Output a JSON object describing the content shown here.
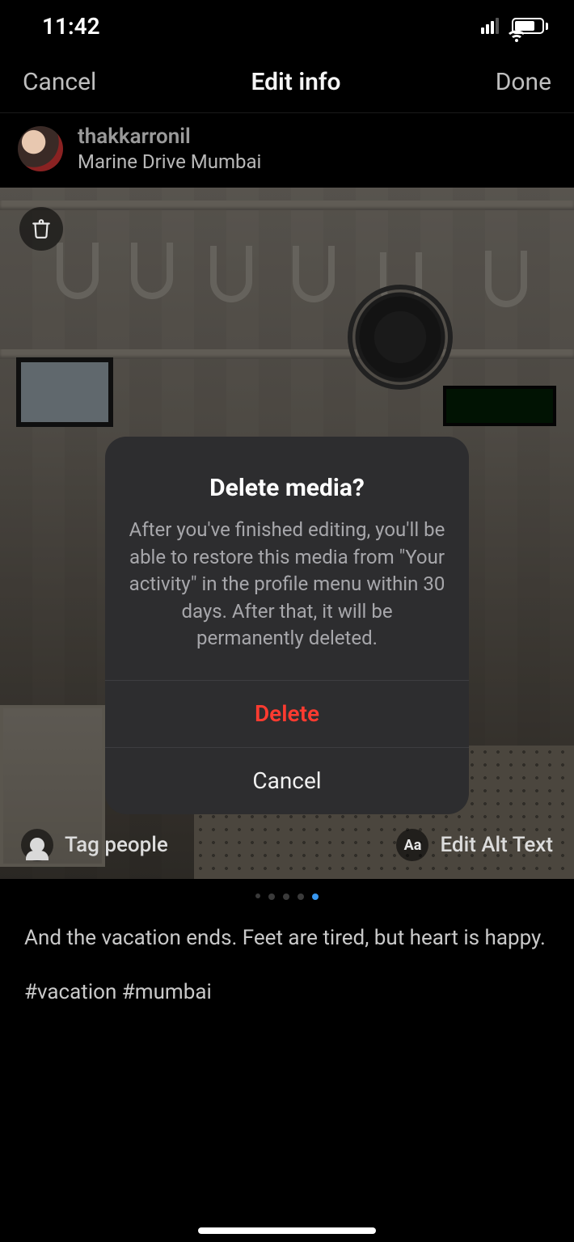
{
  "status": {
    "time": "11:42"
  },
  "nav": {
    "cancel": "Cancel",
    "title": "Edit info",
    "done": "Done"
  },
  "user": {
    "username": "thakkarronil",
    "location": "Marine Drive Mumbai"
  },
  "photo": {
    "trash_icon": "trash-icon",
    "tag_people": "Tag people",
    "edit_alt": "Edit Alt Text",
    "alt_icon_text": "Aa"
  },
  "pagination": {
    "count": 5,
    "active_index": 4
  },
  "caption": {
    "line1": "And the vacation ends. Feet are tired, but heart is happy.",
    "line2": "#vacation #mumbai"
  },
  "modal": {
    "title": "Delete media?",
    "body": "After you've finished editing, you'll be able to restore this media from \"Your activity\" in the profile menu within 30 days. After that, it will be permanently deleted.",
    "delete": "Delete",
    "cancel": "Cancel"
  }
}
